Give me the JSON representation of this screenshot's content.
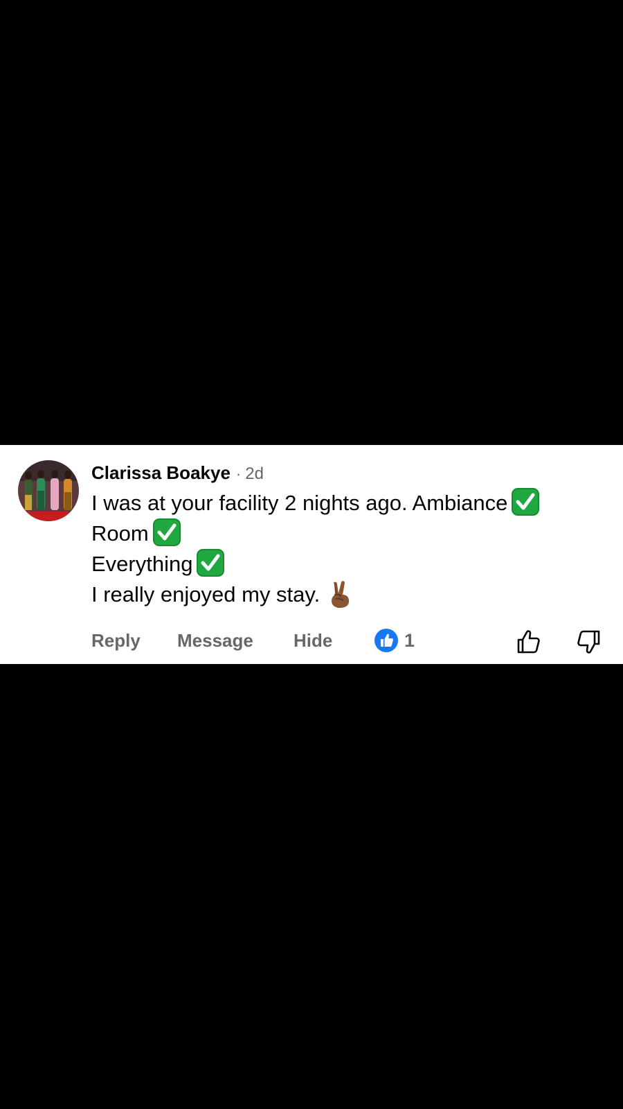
{
  "comment": {
    "author": "Clarissa Boakye",
    "separator": "·",
    "time_ago": "2d",
    "lines": {
      "line1": "I was at your facility 2 nights ago. Ambiance",
      "line2": "Room",
      "line3": "Everything",
      "line4": "I really enjoyed my stay."
    }
  },
  "actions": {
    "reply_label": "Reply",
    "message_label": "Message",
    "hide_label": "Hide"
  },
  "reactions": {
    "type": "like",
    "count": "1"
  },
  "icons": {
    "like_badge": "like-badge-icon",
    "upvote": "thumbs-up-outline-icon",
    "downvote": "thumbs-down-outline-icon",
    "check": "check-mark-button-emoji",
    "peace": "victory-hand-emoji"
  },
  "colors": {
    "background": "#000000",
    "card": "#ffffff",
    "text_primary": "#050505",
    "text_secondary": "#65676b",
    "like_blue": "#1877f2",
    "check_green": "#1fa83f"
  }
}
